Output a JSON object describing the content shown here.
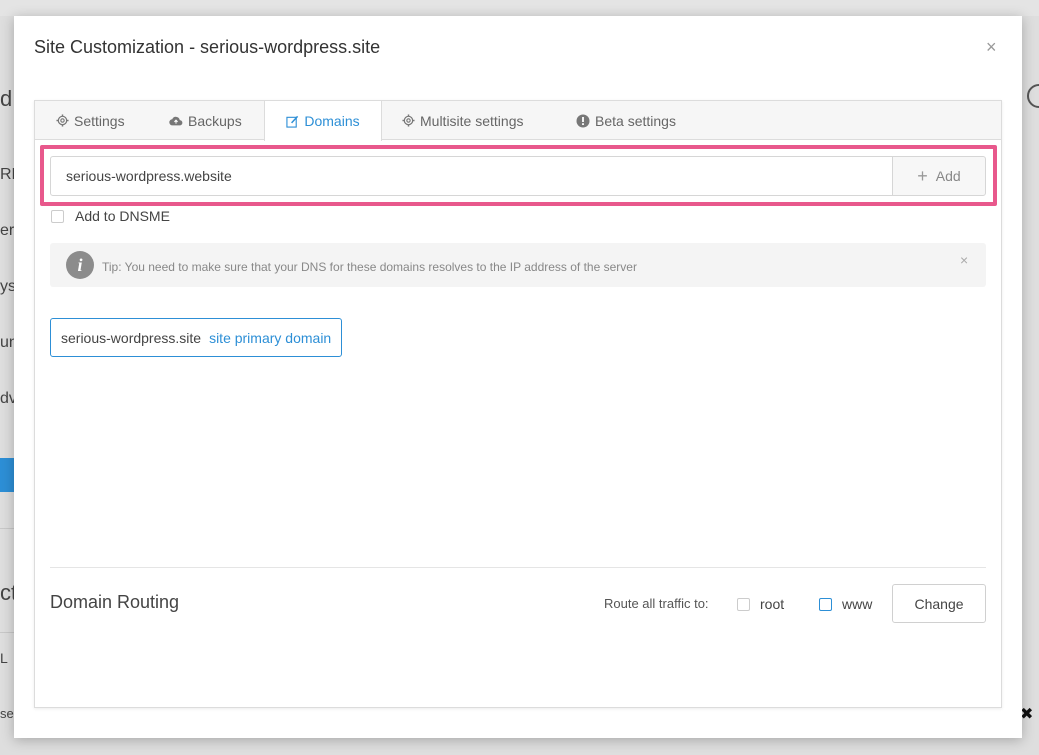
{
  "modal": {
    "title": "Site Customization - serious-wordpress.site",
    "close_glyph": "×"
  },
  "tabs": [
    {
      "label": "Settings",
      "icon": "gear-icon",
      "active": false
    },
    {
      "label": "Backups",
      "icon": "cloud-icon",
      "active": false
    },
    {
      "label": "Domains",
      "icon": "edit-icon",
      "active": true
    },
    {
      "label": "Multisite settings",
      "icon": "gear-icon",
      "active": false
    },
    {
      "label": "Beta settings",
      "icon": "exclamation-circle-icon",
      "active": false
    }
  ],
  "domain_form": {
    "input_value": "serious-wordpress.website",
    "add_label": "Add",
    "add_icon": "plus-icon",
    "dnsme_label": "Add to DNSME",
    "dnsme_checked": false
  },
  "tip": {
    "icon": "info-icon",
    "icon_glyph": "i",
    "text": "Tip: You need to make sure that your DNS for these domains resolves to the IP address of the server",
    "close_glyph": "×"
  },
  "domains": [
    {
      "name": "serious-wordpress.site",
      "badge": "site primary domain"
    }
  ],
  "routing": {
    "title": "Domain Routing",
    "label": "Route all traffic to:",
    "options": [
      {
        "label": "root",
        "checked": false
      },
      {
        "label": "www",
        "checked": false
      }
    ],
    "change_label": "Change"
  },
  "background": {
    "fragments": [
      "d",
      "RL",
      "erv",
      "yst",
      "un",
      "dv",
      "ct",
      "L",
      "se"
    ],
    "close_glyph": "✖"
  },
  "colors": {
    "accent": "#2d8fd6",
    "highlight": "#e8588c"
  }
}
